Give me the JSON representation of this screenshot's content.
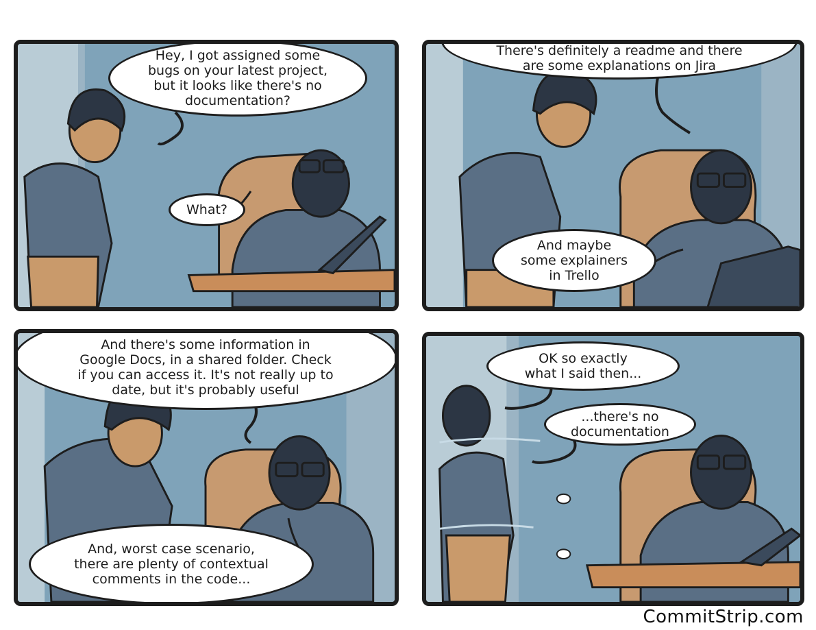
{
  "colors": {
    "wall": "#7fa3b9",
    "door_frame": "#b9ccd6",
    "skin": "#c99a6b",
    "shirt": "#5a6f85",
    "hair": "#2c3644",
    "chair": "#c79a70",
    "desk": "#c98d5a",
    "outline": "#1d1d1d"
  },
  "panels": [
    {
      "bubbles": [
        {
          "text": "Hey, I got assigned some\nbugs on your latest project,\nbut it looks like there's no\ndocumentation?"
        },
        {
          "text": "What?"
        }
      ]
    },
    {
      "bubbles": [
        {
          "text": "Of course there's documentation!\nThere's definitely a readme and there\nare some explanations on Jira"
        },
        {
          "text": "And maybe\nsome explainers\nin Trello"
        }
      ]
    },
    {
      "bubbles": [
        {
          "text": "And there's some information in\nGoogle Docs, in a shared folder. Check\nif you can access it. It's not really up to\ndate, but it's probably useful"
        },
        {
          "text": "And, worst case scenario,\nthere are plenty of contextual\ncomments in the code..."
        }
      ]
    },
    {
      "bubbles": [
        {
          "text": "OK so exactly\nwhat I said then..."
        },
        {
          "text": "...there's no\ndocumentation"
        }
      ]
    }
  ],
  "credit": "CommitStrip.com"
}
